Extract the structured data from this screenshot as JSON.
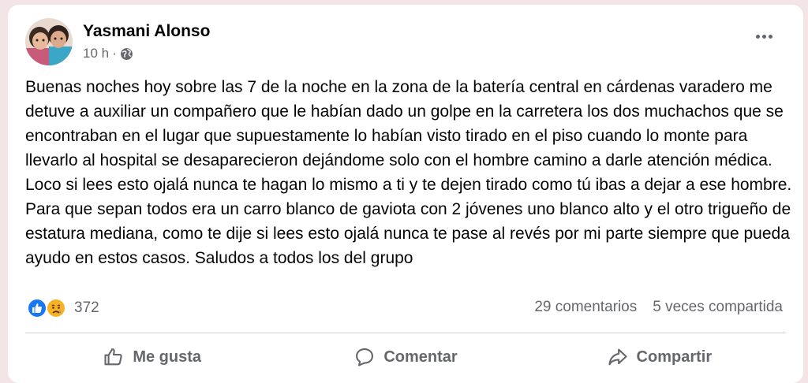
{
  "post": {
    "author": "Yasmani Alonso",
    "time": "10 h",
    "separator": "·",
    "text": "Buenas noches hoy sobre las 7 de la noche en la zona de la batería central en cárdenas varadero me detuve a auxiliar un compañero que le habían dado un golpe en la carretera los dos muchachos que se encontraban en el lugar que supuestamente lo habían visto tirado en el piso cuando lo monte para llevarlo al hospital se desaparecieron dejándome solo con el hombre camino a darle atención médica. Loco si lees esto ojalá nunca te hagan lo mismo a ti y te dejen tirado como tú ibas a dejar a ese hombre. Para que sepan todos era un carro blanco de gaviota con 2 jóvenes uno blanco alto y el otro trigueño de estatura mediana, como te dije si lees esto ojalá nunca te pase al revés por mi parte siempre que pueda ayudo en estos casos. Saludos a todos los del grupo"
  },
  "engagement": {
    "reaction_count": "372",
    "reaction_icons": [
      "like-icon",
      "sad-icon"
    ],
    "comments": "29 comentarios",
    "shares": "5 veces compartida"
  },
  "actions": {
    "like": "Me gusta",
    "comment": "Comentar",
    "share": "Compartir"
  },
  "colors": {
    "background": "#f3e4e7",
    "card": "#ffffff",
    "text": "#050505",
    "secondary": "#65676b",
    "like_blue": "#1877f2",
    "sad_yellow": "#f7b125"
  }
}
